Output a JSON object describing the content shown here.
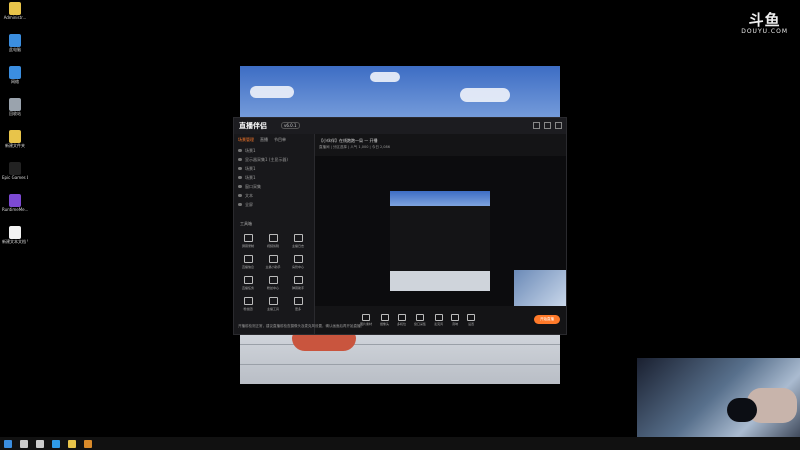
{
  "desktop_icons": [
    {
      "label": "Administr...",
      "icon": "folder-user-icon",
      "color": "#e8c44a"
    },
    {
      "label": "此电脑",
      "icon": "computer-icon",
      "color": "#3b8ee0"
    },
    {
      "label": "网络",
      "icon": "network-icon",
      "color": "#3b8ee0"
    },
    {
      "label": "回收站",
      "icon": "recycle-bin-icon",
      "color": "#9aa3ad"
    },
    {
      "label": "新建文件夹",
      "icon": "folder-icon",
      "color": "#e8c44a"
    },
    {
      "label": "Epic Games Launcher",
      "icon": "epic-icon",
      "color": "#222222"
    },
    {
      "label": "RuntimeMe...",
      "icon": "runtime-icon",
      "color": "#7d4ad4"
    },
    {
      "label": "新建文本文档 Word",
      "icon": "document-icon",
      "color": "#f2f2f2"
    }
  ],
  "watermark": {
    "logo": "斗鱼",
    "url": "DOUYU.COM"
  },
  "app": {
    "logo": "直播伴侣",
    "version": "v6.0.1",
    "tabs": [
      "场景管理",
      "直播",
      "节目单"
    ],
    "scenes": [
      "场景1",
      "显示器采集1 (主显示器)",
      "场景1",
      "场景1",
      "窗口采集",
      "文本",
      "全屏"
    ],
    "tools_title": "工具箱",
    "tools": [
      "屏幕录制",
      "视频剪辑",
      "主播日志",
      "直播信息",
      "主播小助手",
      "房管中心",
      "直播任务",
      "粉丝中心",
      "弹幕助手",
      "粉丝团",
      "主播工具",
      "更多"
    ],
    "room_title": "【小伙伴】在线跑跑一局 — 开播",
    "room_sub": "直播间 | 分区选择 | 人气 1,000 | 今日 2,086",
    "bottom_actions": [
      "图片素材",
      "摄像头",
      "多机位",
      "窗口采集",
      "麦克风",
      "音响",
      "设置"
    ],
    "start_label": "开始直播",
    "status_text": "开播前检测正常，建议直播前检查摄像头及麦克风设置，确认画面后再开始直播。"
  },
  "taskbar": {
    "items": [
      "start-icon",
      "search-icon",
      "task-view-icon",
      "edge-icon",
      "explorer-icon",
      "app-icon"
    ]
  }
}
